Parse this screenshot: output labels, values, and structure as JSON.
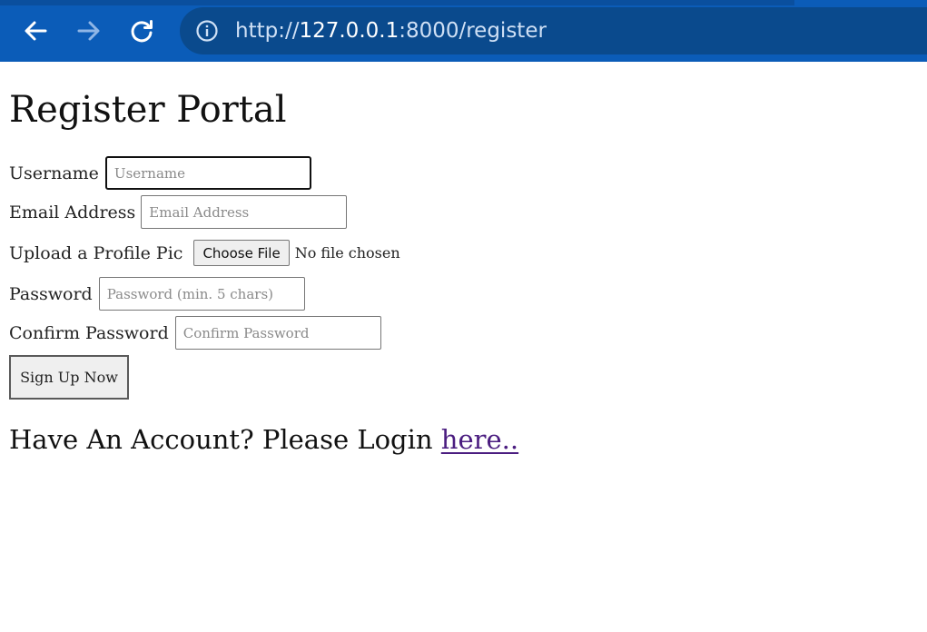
{
  "browser": {
    "url_scheme": "http://",
    "url_host": "127.0.0.1",
    "url_rest": ":8000/register",
    "colors": {
      "toolbar": "#0b5cb8",
      "address_bar": "#0a4a8d"
    },
    "icons": {
      "back": "arrow-left-icon",
      "forward": "arrow-right-icon",
      "reload": "reload-icon",
      "site_info": "info-circle-icon"
    }
  },
  "page": {
    "title": "Register Portal",
    "form": {
      "username": {
        "label": "Username",
        "placeholder": "Username",
        "value": ""
      },
      "email": {
        "label": "Email Address",
        "placeholder": "Email Address",
        "value": ""
      },
      "profile_pic": {
        "label": "Upload a Profile Pic",
        "button_label": "Choose File",
        "status": "No file chosen"
      },
      "password": {
        "label": "Password",
        "placeholder": "Password (min. 5 chars)",
        "value": ""
      },
      "confirm_password": {
        "label": "Confirm Password",
        "placeholder": "Confirm Password",
        "value": ""
      },
      "submit_label": "Sign Up Now"
    },
    "login_prompt": {
      "text": "Have An Account? Please Login ",
      "link_text": "here..",
      "link_color": "#4b1d80"
    }
  }
}
